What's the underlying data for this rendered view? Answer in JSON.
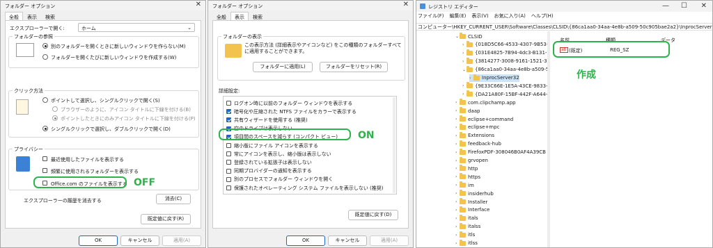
{
  "dialog1": {
    "title": "フォルダー オプション",
    "tabs": [
      "全般",
      "表示",
      "検索"
    ],
    "open_explorer_label": "エクスプローラーで開く:",
    "open_explorer_value": "ホーム",
    "browse_group": "フォルダーの参照",
    "browse_same": "同じウィンドウでフォルダーを開く(M)",
    "browse_new": "フォルダーを開くたびに新しいウィンドウを作成する(W)",
    "browse_same_pre": "別のフォルダーを開くときに新しいウィンドウを作らない(M)",
    "click_group": "クリック方法",
    "click_single": "ポイントして選択し、シングルクリックで開く(S)",
    "click_sub1": "ブラウザーのように、アイコン タイトルに下線を付ける(B)",
    "click_sub2": "ポイントしたときにのみアイコン タイトルに下線を付ける(P)",
    "click_double": "シングルクリックで選択し、ダブルクリックで開く(D)",
    "privacy_group": "プライバシー",
    "privacy_recent": "最近使用したファイルを表示する",
    "privacy_frequent": "頻繁に使用されるフォルダーを表示する",
    "privacy_office": "Office.com のファイルを表示する",
    "clear_history_label": "エクスプローラーの履歴を消去する",
    "clear_button": "消去(C)",
    "restore_defaults": "既定値に戻す(R)",
    "ok": "OK",
    "cancel": "キャンセル",
    "apply": "適用(A)",
    "annotation": "OFF"
  },
  "dialog2": {
    "title": "フォルダー オプション",
    "tabs": [
      "全般",
      "表示",
      "検索"
    ],
    "folder_view_group": "フォルダーの表示",
    "folder_view_desc": "この表示方法 (詳細表示やアイコンなど) をこの種類のフォルダーすべてに適用することができます。",
    "apply_to_folders": "フォルダーに適用(L)",
    "reset_folders": "フォルダーをリセット(R)",
    "advanced_label": "詳細設定:",
    "settings": [
      {
        "label": "ログオン時に以前のフォルダー ウィンドウを表示する",
        "checked": false
      },
      {
        "label": "暗号化や圧縮された NTFS ファイルをカラーで表示する",
        "checked": true
      },
      {
        "label": "共有ウィザードを使用する (推奨)",
        "checked": true
      },
      {
        "label": "空のドライブは表示しない",
        "checked": true
      },
      {
        "label": "項目間のスペースを減らす (コンパクト ビュー)",
        "checked": true
      },
      {
        "label": "縮小版にファイル アイコンを表示する",
        "checked": false
      },
      {
        "label": "常にアイコンを表示し、縮小版は表示しない",
        "checked": false
      },
      {
        "label": "登録されている拡張子は表示しない",
        "checked": false
      },
      {
        "label": "同期プロバイダーの通知を表示する",
        "checked": false
      },
      {
        "label": "別のプロセスでフォルダー ウィンドウを開く",
        "checked": false
      },
      {
        "label": "保護されたオペレーティング システム ファイルを表示しない (推奨)",
        "checked": false
      }
    ],
    "restore_defaults": "既定値に戻す(D)",
    "ok": "OK",
    "cancel": "キャンセル",
    "apply": "適用(A)",
    "annotation": "ON"
  },
  "regedit": {
    "title": "レジストリ エディター",
    "menu": [
      "ファイル(F)",
      "編集(E)",
      "表示(V)",
      "お気に入り(A)",
      "ヘルプ(H)"
    ],
    "address": "コンピューター\\HKEY_CURRENT_USER\\Software\\Classes\\CLSID\\{86ca1aa0-34aa-4e8b-a509-50c905bae2a2}\\InprocServer32",
    "tree": [
      {
        "label": "CLSID",
        "indent": 0,
        "expanded": true
      },
      {
        "label": "{018D5C66-4533-4307-9B53-22",
        "indent": 1
      },
      {
        "label": "{031E4825-7B94-4dc3-B131-E9",
        "indent": 1
      },
      {
        "label": "{3814277-3008-9161-1521-34",
        "indent": 1
      },
      {
        "label": "{86ca1aa0-34aa-4e8b-a509-50",
        "indent": 1,
        "expanded": true
      },
      {
        "label": "InprocServer32",
        "indent": 2,
        "selected": true
      },
      {
        "label": "{9E33C66E-1E5A-43CE-9833-98",
        "indent": 1
      },
      {
        "label": "{DA21A80F-15BF-442F-A644-6",
        "indent": 1
      },
      {
        "label": "com.clipchamp.app",
        "indent": 0
      },
      {
        "label": "daap",
        "indent": 0
      },
      {
        "label": "eclipse+command",
        "indent": 0
      },
      {
        "label": "eclipse+mpc",
        "indent": 0
      },
      {
        "label": "Extensions",
        "indent": 0
      },
      {
        "label": "feedback-hub",
        "indent": 0
      },
      {
        "label": "FirefoxPDF-308046B0AF4A39CB",
        "indent": 0
      },
      {
        "label": "grvopen",
        "indent": 0
      },
      {
        "label": "http",
        "indent": 0
      },
      {
        "label": "https",
        "indent": 0
      },
      {
        "label": "im",
        "indent": 0
      },
      {
        "label": "insiderhub",
        "indent": 0
      },
      {
        "label": "Installer",
        "indent": 0
      },
      {
        "label": "Interface",
        "indent": 0
      },
      {
        "label": "itals",
        "indent": 0
      },
      {
        "label": "italss",
        "indent": 0
      },
      {
        "label": "itls",
        "indent": 0
      },
      {
        "label": "itlss",
        "indent": 0
      }
    ],
    "col_name": "名前",
    "col_type": "種類",
    "col_data": "データ",
    "value_icon": "ab",
    "value_name": "(既定)",
    "value_type": "REG_SZ",
    "annotation": "作成"
  },
  "colors": {
    "accent": "#1f65c9",
    "annotation": "#2db34a"
  }
}
